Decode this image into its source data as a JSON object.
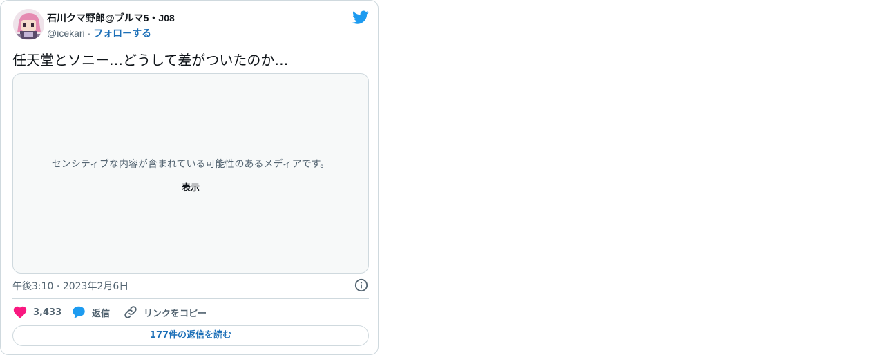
{
  "author": {
    "display_name": "石川クマ野郎@ブルマ5・J08",
    "handle": "@icekari",
    "separator": "·",
    "follow_label": "フォローする"
  },
  "tweet": {
    "text": "任天堂とソニー…どうして差がついたのか…",
    "media": {
      "sensitive_message": "センシティブな内容が含まれている可能性のあるメディアです。",
      "show_label": "表示"
    },
    "time": "午後3:10",
    "date_separator": "·",
    "date": "2023年2月6日"
  },
  "actions": {
    "like_count": "3,433",
    "reply_label": "返信",
    "copy_link_label": "リンクをコピー"
  },
  "read_replies_label": "177件の返信を読む",
  "colors": {
    "like": "#f91880",
    "reply": "#1d9bf0",
    "twitter_brand": "#1d9bf0",
    "link": "#1d70b8",
    "muted": "#536471"
  },
  "icons": [
    "avatar",
    "twitter-bird-icon",
    "info-icon",
    "heart-icon",
    "reply-bubble-icon",
    "link-icon"
  ]
}
